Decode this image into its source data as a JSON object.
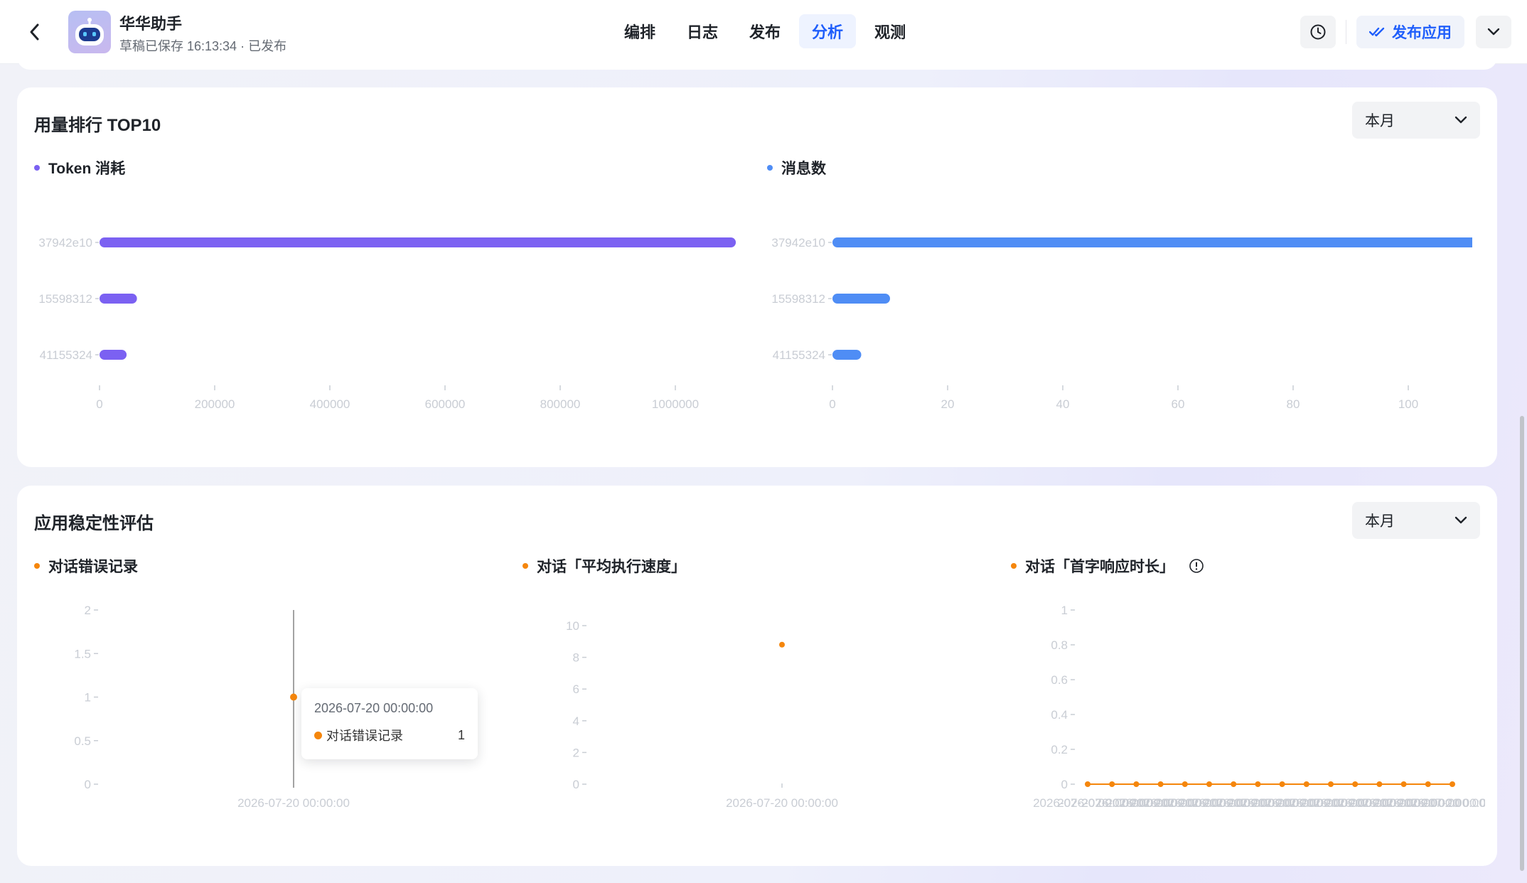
{
  "header": {
    "app_name": "华华助手",
    "status": "草稿已保存 16:13:34 · 已发布",
    "tabs": [
      {
        "label": "编排",
        "active": false
      },
      {
        "label": "日志",
        "active": false
      },
      {
        "label": "发布",
        "active": false
      },
      {
        "label": "分析",
        "active": true
      },
      {
        "label": "观测",
        "active": false
      }
    ],
    "publish_label": "发布应用",
    "icons": {
      "back": "chevron-left-icon",
      "history": "clock-icon",
      "publish": "double-check-icon",
      "more": "chevron-down-icon"
    },
    "accent_color": "#1f5efb"
  },
  "usage": {
    "title": "用量排行 TOP10",
    "period": "本月",
    "token_label": "Token 消耗",
    "messages_label": "消息数"
  },
  "stability": {
    "title": "应用稳定性评估",
    "period": "本月",
    "errors_label": "对话错误记录",
    "speed_label": "对话「平均执行速度」",
    "first_response_label": "对话「首字响应时长」",
    "info_icon": "info-circle-icon",
    "tooltip": {
      "date": "2026-07-20 00:00:00",
      "series": "对话错误记录",
      "value": "1"
    }
  },
  "chart_data": [
    {
      "type": "bar",
      "orientation": "horizontal",
      "color": "#7b61f2",
      "categories": [
        "37942e10",
        "15598312",
        "41155324"
      ],
      "values": [
        1105000,
        65000,
        47000
      ],
      "xticks": [
        "0",
        "200000",
        "400000",
        "600000",
        "800000",
        "1000000"
      ],
      "xlim": [
        0,
        1100000
      ]
    },
    {
      "type": "bar",
      "orientation": "horizontal",
      "color": "#4f8df5",
      "categories": [
        "37942e10",
        "15598312",
        "41155324"
      ],
      "values": [
        113,
        10,
        5
      ],
      "xticks": [
        "0",
        "20",
        "40",
        "60",
        "80",
        "100"
      ],
      "xlim": [
        0,
        113
      ]
    },
    {
      "type": "scatter",
      "color": "#f5860c",
      "x": [
        "2026-07-20 00:00:00"
      ],
      "values": [
        1
      ],
      "yticks": [
        "0",
        "0.5",
        "1",
        "1.5",
        "2"
      ],
      "ylim": [
        0,
        2
      ]
    },
    {
      "type": "scatter",
      "color": "#f5860c",
      "x": [
        "2026-07-20 00:00:00"
      ],
      "values": [
        8.8
      ],
      "yticks": [
        "0",
        "2",
        "4",
        "6",
        "8",
        "10"
      ],
      "ylim": [
        0,
        10
      ]
    },
    {
      "type": "line",
      "color": "#f5860c",
      "x_label_overlap": "2026-07-20 00:00:00",
      "values": [
        0,
        0,
        0,
        0,
        0,
        0,
        0,
        0,
        0,
        0,
        0,
        0,
        0,
        0,
        0,
        0
      ],
      "yticks": [
        "0",
        "0.2",
        "0.4",
        "0.6",
        "0.8",
        "1"
      ],
      "ylim": [
        0,
        1
      ]
    }
  ]
}
